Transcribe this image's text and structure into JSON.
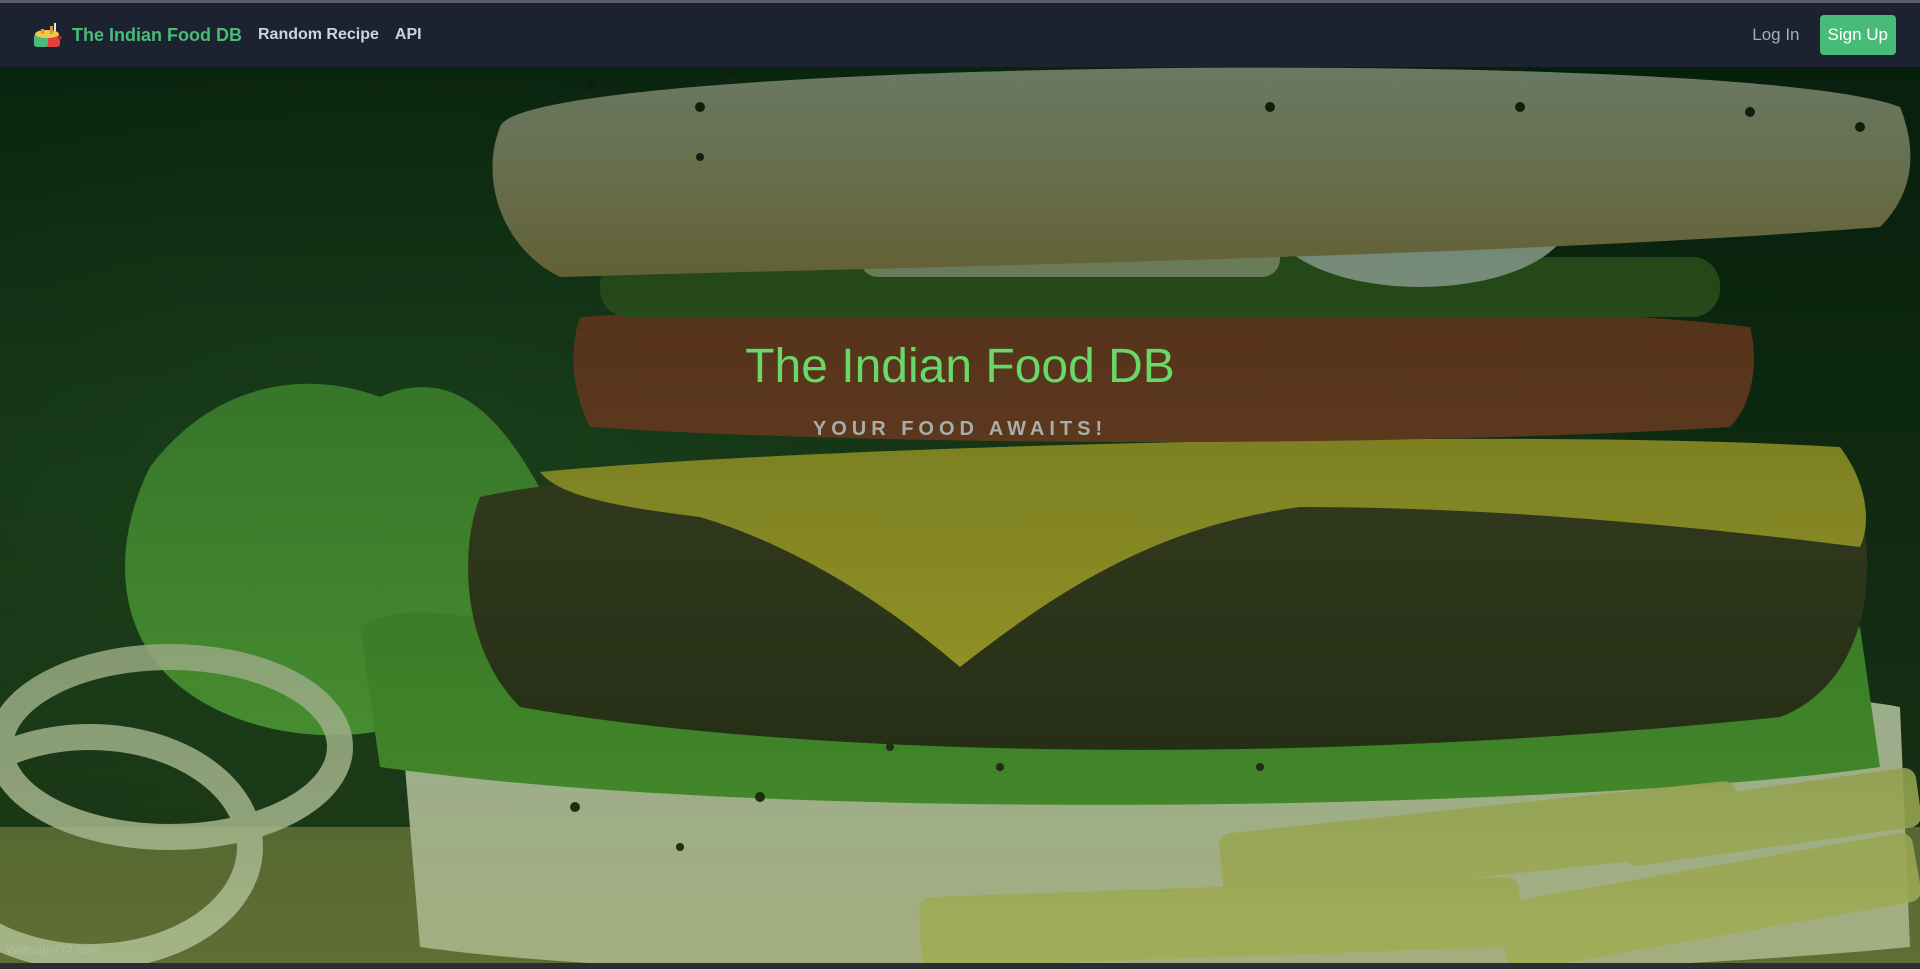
{
  "nav": {
    "brand": "The Indian Food DB",
    "brand_icon": "food-pot-icon",
    "links": [
      "Random Recipe",
      "API"
    ],
    "login": "Log In",
    "signup": "Sign Up"
  },
  "hero": {
    "title": "The Indian Food DB",
    "subtitle": "YOUR FOOD AWAITS!",
    "background_image": "burger-photo",
    "watermark": "Wallpaper77.com"
  },
  "colors": {
    "accent": "#48bb78",
    "navbar": "#1d2230",
    "hero_title": "#68d868"
  }
}
